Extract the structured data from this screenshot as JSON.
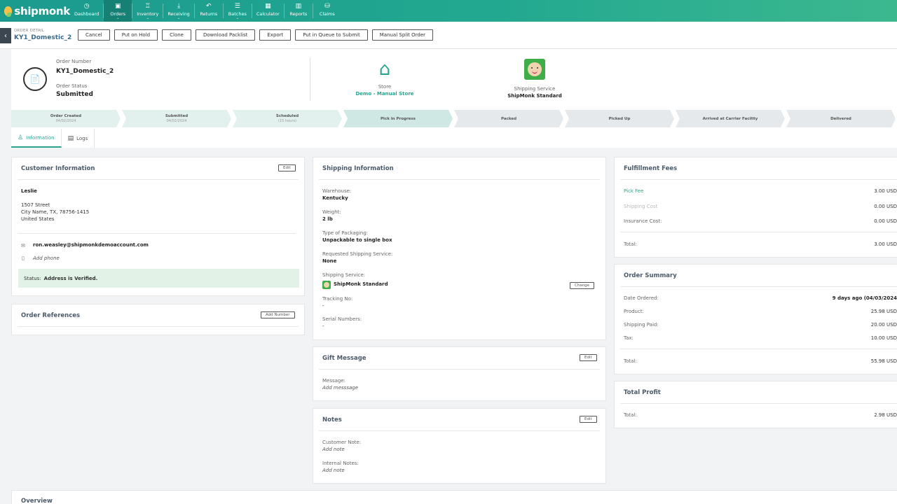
{
  "nav": {
    "brand": "shipmonk",
    "items": [
      {
        "label": "Dashboard",
        "icon": "◷",
        "chev": ""
      },
      {
        "label": "Orders",
        "icon": "▣",
        "chev": "⌄"
      },
      {
        "label": "Inventory",
        "icon": "♖",
        "chev": "⌄"
      },
      {
        "label": "Receiving",
        "icon": "⤓",
        "chev": "⌄"
      },
      {
        "label": "Returns",
        "icon": "↶",
        "chev": ""
      },
      {
        "label": "Batches",
        "icon": "☰",
        "chev": "⌄"
      },
      {
        "label": "Calculator",
        "icon": "▦",
        "chev": ""
      },
      {
        "label": "Reports",
        "icon": "▥",
        "chev": ""
      },
      {
        "label": "Claims",
        "icon": "⛁",
        "chev": ""
      }
    ]
  },
  "header": {
    "back_icon": "‹",
    "label": "ORDER DETAIL",
    "title": "KY1_Domestic_2",
    "actions": [
      "Cancel",
      "Put on Hold",
      "Clone",
      "Download Packlist",
      "Export",
      "Put in Queue to Submit",
      "Manual Split Order"
    ]
  },
  "order": {
    "icon": "📄",
    "number_label": "Order Number",
    "number": "KY1_Domestic_2",
    "status_label": "Order Status",
    "status": "Submitted",
    "store_icon": "⌂",
    "store_label": "Store",
    "store_value": "Demo - Manual Store",
    "ship_label": "Shipping Service",
    "ship_value": "ShipMonk Standard"
  },
  "steps": [
    {
      "name": "Order Created",
      "date": "04/02/2024",
      "state": "done"
    },
    {
      "name": "Submitted",
      "date": "04/02/2024",
      "state": "done"
    },
    {
      "name": "Scheduled",
      "date": "(15 hours)",
      "state": "done"
    },
    {
      "name": "Pick in Progress",
      "date": "",
      "state": "current"
    },
    {
      "name": "Packed",
      "date": "",
      "state": "todo"
    },
    {
      "name": "Picked Up",
      "date": "",
      "state": "todo"
    },
    {
      "name": "Arrived at Carrier Facility",
      "date": "",
      "state": "todo"
    },
    {
      "name": "Delivered",
      "date": "",
      "state": "todo"
    }
  ],
  "tabs": [
    {
      "label": "Information",
      "icon": "♙"
    },
    {
      "label": "Logs",
      "icon": "▤"
    }
  ],
  "customer": {
    "title": "Customer Information",
    "edit": "Edit",
    "name": "Leslie",
    "address1": "1507 Street",
    "address2": "City Name, TX, 78756-1415",
    "country": "United States",
    "email_icon": "✉",
    "email": "ron.weasley@shipmonkdemoaccount.com",
    "phone_icon": "▯",
    "phone": "Add phone",
    "status_label": "Status:",
    "status_value": "Address is Verified."
  },
  "references": {
    "title": "Order References",
    "add": "Add Number"
  },
  "shipping": {
    "title": "Shipping Information",
    "warehouse_label": "Warehouse:",
    "warehouse": "Kentucky",
    "weight_label": "Weight:",
    "weight": "2 lb",
    "packaging_label": "Type of Packaging:",
    "packaging": "Unpackable to single box",
    "req_label": "Requested Shipping Service:",
    "req": "None",
    "service_label": "Shipping Service:",
    "service": "ShipMonk Standard",
    "change": "Change",
    "tracking_label": "Tracking No:",
    "tracking": "-",
    "serial_label": "Serial Numbers:",
    "serial": "-"
  },
  "gift": {
    "title": "Gift Message",
    "edit": "Edit",
    "message_label": "Message:",
    "message": "Add messsage"
  },
  "notes": {
    "title": "Notes",
    "edit": "Edit",
    "customer_label": "Customer Note:",
    "customer": "Add note",
    "internal_label": "Internal Notes:",
    "internal": "Add note"
  },
  "fees": {
    "title": "Fulfillment Fees",
    "pick_label": "Pick Fee",
    "pick": "3.00 USD",
    "shipping_label": "Shipping Cost",
    "shipping": "0.00 USD",
    "insurance_label": "Insurance Cost:",
    "insurance": "0.00 USD",
    "total_label": "Total:",
    "total": "3.00 USD"
  },
  "summary": {
    "title": "Order Summary",
    "date_label": "Date Ordered:",
    "date": "9 days ago (04/03/2024",
    "product_label": "Product:",
    "product": "25.98 USD",
    "shipping_label": "Shipping Paid:",
    "shipping": "20.00 USD",
    "tax_label": "Tax:",
    "tax": "10.00 USD",
    "total_label": "Total:",
    "total": "55.98 USD"
  },
  "profit": {
    "title": "Total Profit",
    "total_label": "Total:",
    "total": "2.98 USD"
  },
  "overview": {
    "title": "Overview"
  },
  "colors": {
    "accent": "#2aa58f",
    "nav_start": "#1b9a8e",
    "nav_end": "#3cb88f",
    "verified_bg": "#e3f2e6"
  }
}
